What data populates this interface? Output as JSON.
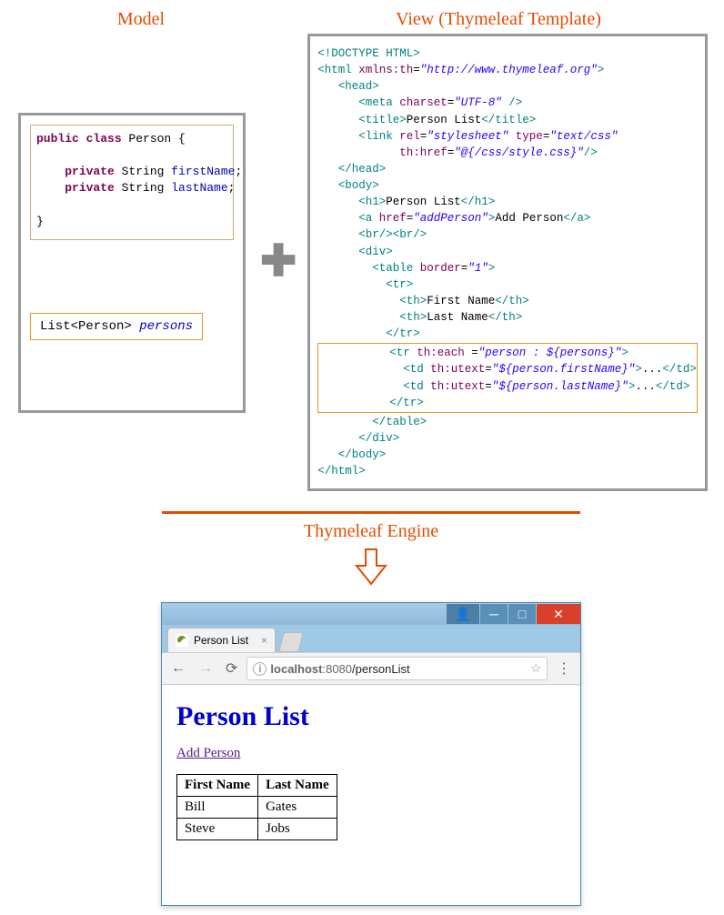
{
  "labels": {
    "model": "Model",
    "view": "View (Thymeleaf Template)",
    "engine": "Thymeleaf Engine"
  },
  "model_code": {
    "line1_a": "public class",
    "line1_b": " Person {",
    "line2_a": "private",
    "line2_b": " String ",
    "line2_c": "firstName",
    "line2_d": ";",
    "line3_a": "private",
    "line3_b": " String ",
    "line3_c": "lastName",
    "line3_d": ";",
    "line4": "}"
  },
  "list_expr": {
    "a": "List<Person> ",
    "b": "persons"
  },
  "template": {
    "l1": "<!DOCTYPE HTML>",
    "l2a": "<html",
    "l2b": " xmlns:th",
    "l2c": "=",
    "l2d": "\"http://www.thymeleaf.org\"",
    "l2e": ">",
    "l3": "<head>",
    "l4a": "<meta",
    "l4b": " charset",
    "l4c": "=",
    "l4d": "\"UTF-8\"",
    "l4e": " />",
    "l5a": "<title>",
    "l5b": "Person List",
    "l5c": "</title>",
    "l6a": "<link",
    "l6b": " rel",
    "l6c": "=",
    "l6d": "\"stylesheet\"",
    "l6e": " type",
    "l6f": "=",
    "l6g": "\"text/css\"",
    "l7a": "th:href",
    "l7b": "=",
    "l7c": "\"@{/css/style.css}\"",
    "l7d": "/>",
    "l8": "</head>",
    "l9": "<body>",
    "l10a": "<h1>",
    "l10b": "Person List",
    "l10c": "</h1>",
    "l11a": "<a",
    "l11b": " href",
    "l11c": "=",
    "l11d": "\"addPerson\"",
    "l11e": ">",
    "l11f": "Add Person",
    "l11g": "</a>",
    "l12": "<br/><br/>",
    "l13": "<div>",
    "l14a": "<table",
    "l14b": " border",
    "l14c": "=",
    "l14d": "\"1\"",
    "l14e": ">",
    "l15": "<tr>",
    "l16a": "<th>",
    "l16b": "First Name",
    "l16c": "</th>",
    "l17a": "<th>",
    "l17b": "Last Name",
    "l17c": "</th>",
    "l18": "</tr>",
    "h1a": "<tr",
    "h1b": " th:each ",
    "h1c": "=",
    "h1d": "\"person : ${persons}\"",
    "h1e": ">",
    "h2a": "<td",
    "h2b": " th:utext",
    "h2c": "=",
    "h2d": "\"${person.firstName}\"",
    "h2e": ">",
    "h2f": "...",
    "h2g": "</td>",
    "h3a": "<td",
    "h3b": " th:utext",
    "h3c": "=",
    "h3d": "\"${person.lastName}\"",
    "h3e": ">",
    "h3f": "...",
    "h3g": "</td>",
    "h4": "</tr>",
    "l19": "</table>",
    "l20": "</div>",
    "l21": "</body>",
    "l22": "</html>"
  },
  "browser": {
    "tab_title": "Person List",
    "url_host": "localhost",
    "url_port": ":8080",
    "url_path": "/personList",
    "page_h1": "Person List",
    "add_link": "Add Person",
    "col1": "First Name",
    "col2": "Last Name",
    "rows": [
      {
        "first": "Bill",
        "last": "Gates"
      },
      {
        "first": "Steve",
        "last": "Jobs"
      }
    ]
  }
}
